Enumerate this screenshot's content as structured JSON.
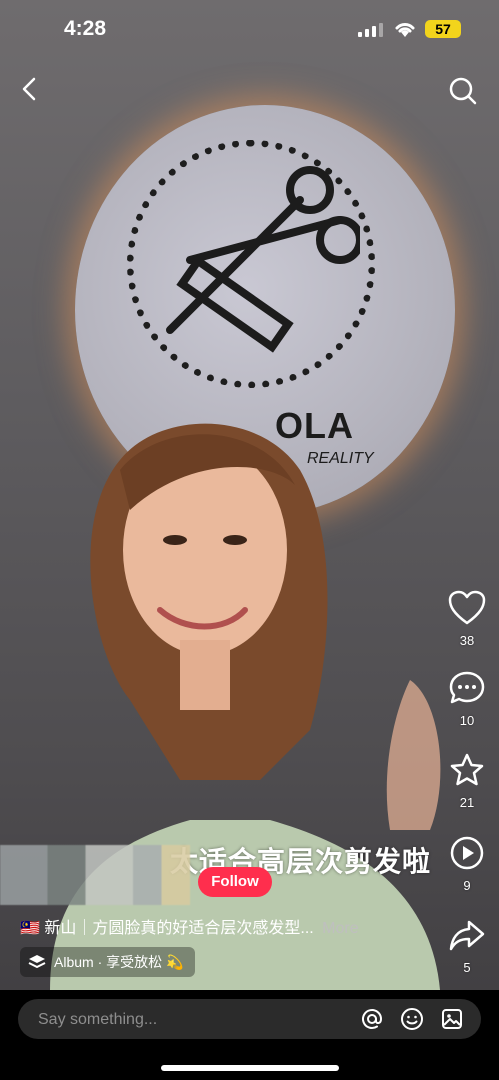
{
  "status_bar": {
    "time": "4:28",
    "battery": "57"
  },
  "overlay_caption": "太适合高层次剪发啦",
  "logo": {
    "text": "OLA",
    "subtext": "REALITY"
  },
  "author": {
    "follow_label": "Follow"
  },
  "description": {
    "flag": "🇲🇾",
    "text": "新山｜方圆脸真的好适合层次感发型...",
    "more_label": "More"
  },
  "album": {
    "label": "Album · 享受放松 💫"
  },
  "actions": {
    "likes": "38",
    "comments": "10",
    "favorites": "21",
    "plays": "9",
    "shares": "5"
  },
  "comment_bar": {
    "placeholder": "Say something..."
  },
  "colors": {
    "follow": "#ff2e4d",
    "battery": "#f2d41c"
  }
}
